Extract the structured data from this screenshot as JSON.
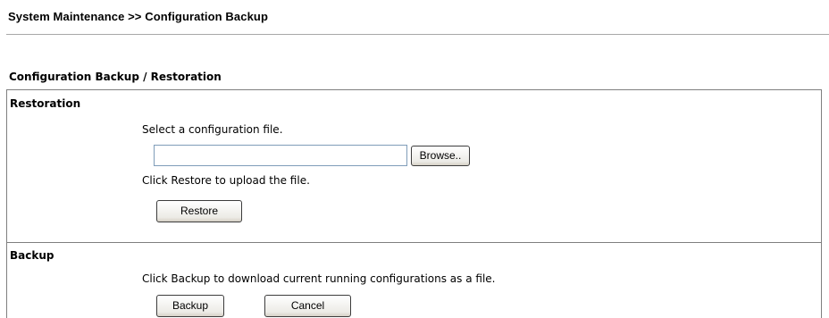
{
  "page": {
    "breadcrumb": "System Maintenance >> Configuration Backup",
    "section_title": "Configuration Backup / Restoration"
  },
  "restoration": {
    "label": "Restoration",
    "select_text": "Select a configuration file.",
    "file_value": "",
    "browse_label": "Browse..",
    "instruction": "Click Restore to upload the file.",
    "restore_label": "Restore"
  },
  "backup": {
    "label": "Backup",
    "instruction": "Click Backup to download current running configurations as a file.",
    "backup_label": "Backup",
    "cancel_label": "Cancel"
  }
}
